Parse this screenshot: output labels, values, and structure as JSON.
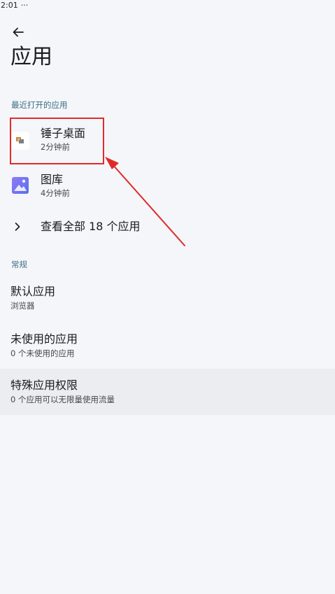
{
  "status_bar": {
    "time": "2:01",
    "more": "···"
  },
  "header": {
    "title": "应用"
  },
  "recent": {
    "section_label": "最近打开的应用",
    "apps": [
      {
        "name": "锤子桌面",
        "time": "2分钟前",
        "icon": "hammer-launcher-icon"
      },
      {
        "name": "图库",
        "time": "4分钟前",
        "icon": "gallery-icon"
      }
    ],
    "see_all": "查看全部 18 个应用"
  },
  "general": {
    "section_label": "常规",
    "items": [
      {
        "title": "默认应用",
        "subtitle": "浏览器"
      },
      {
        "title": "未使用的应用",
        "subtitle": "0 个未使用的应用"
      },
      {
        "title": "特殊应用权限",
        "subtitle": "0 个应用可以无限量使用流量"
      }
    ]
  },
  "colors": {
    "background": "#f5f6f9",
    "section_label": "#3a6f86",
    "highlight": "#e02a2a",
    "pressed_row": "#ecedf0"
  }
}
